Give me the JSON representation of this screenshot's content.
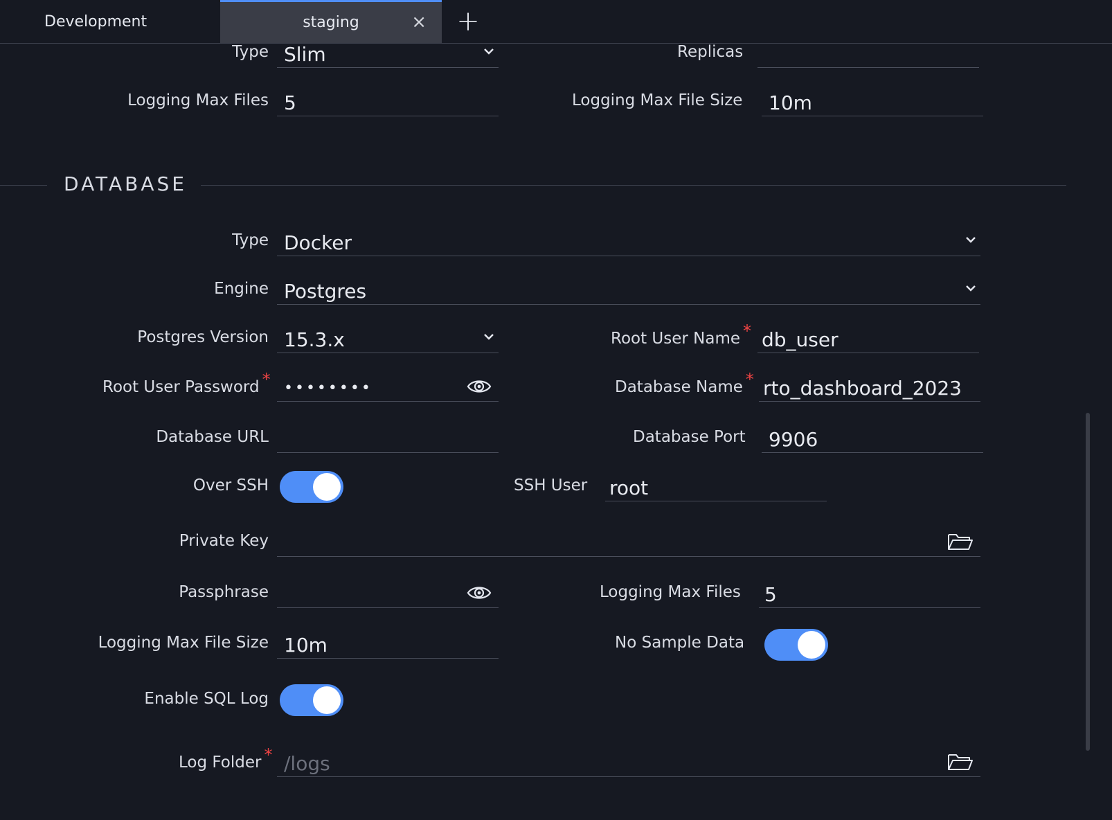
{
  "tabs": [
    {
      "label": "Development"
    },
    {
      "label": "staging",
      "close_icon": "×"
    }
  ],
  "add_tab_icon": "+",
  "app_section": {
    "type_label": "Type",
    "type_value": "Slim",
    "replicas_label": "Replicas",
    "replicas_value": "",
    "logging_max_files_label": "Logging Max Files",
    "logging_max_files_value": "5",
    "logging_max_file_size_label": "Logging Max File Size",
    "logging_max_file_size_value": "10m"
  },
  "database": {
    "section_title": "DATABASE",
    "type_label": "Type",
    "type_value": "Docker",
    "engine_label": "Engine",
    "engine_value": "Postgres",
    "postgres_version_label": "Postgres Version",
    "postgres_version_value": "15.3.x",
    "root_user_name_label": "Root User Name",
    "root_user_name_value": "db_user",
    "root_user_password_label": "Root User Password",
    "root_user_password_value": "••••••••",
    "database_name_label": "Database Name",
    "database_name_value": "rto_dashboard_2023",
    "database_url_label": "Database URL",
    "database_url_value": "",
    "database_port_label": "Database Port",
    "database_port_value": "9906",
    "over_ssh_label": "Over SSH",
    "over_ssh_on": true,
    "ssh_user_label": "SSH User",
    "ssh_user_value": "root",
    "private_key_label": "Private Key",
    "private_key_value": "",
    "passphrase_label": "Passphrase",
    "passphrase_value": "",
    "logging_max_files_label": "Logging Max Files",
    "logging_max_files_value": "5",
    "logging_max_file_size_label": "Logging Max File Size",
    "logging_max_file_size_value": "10m",
    "no_sample_data_label": "No Sample Data",
    "no_sample_data_on": true,
    "enable_sql_log_label": "Enable SQL Log",
    "enable_sql_log_on": true,
    "log_folder_label": "Log Folder",
    "log_folder_placeholder": "/logs",
    "required_mark": "*"
  },
  "colors": {
    "background": "#161922",
    "accent": "#4f8ef7",
    "required": "#ef4444",
    "active_tab": "#3a3d47"
  },
  "icons": [
    "close-icon",
    "plus-icon",
    "chevron-down-icon",
    "eye-icon",
    "folder-open-icon"
  ]
}
